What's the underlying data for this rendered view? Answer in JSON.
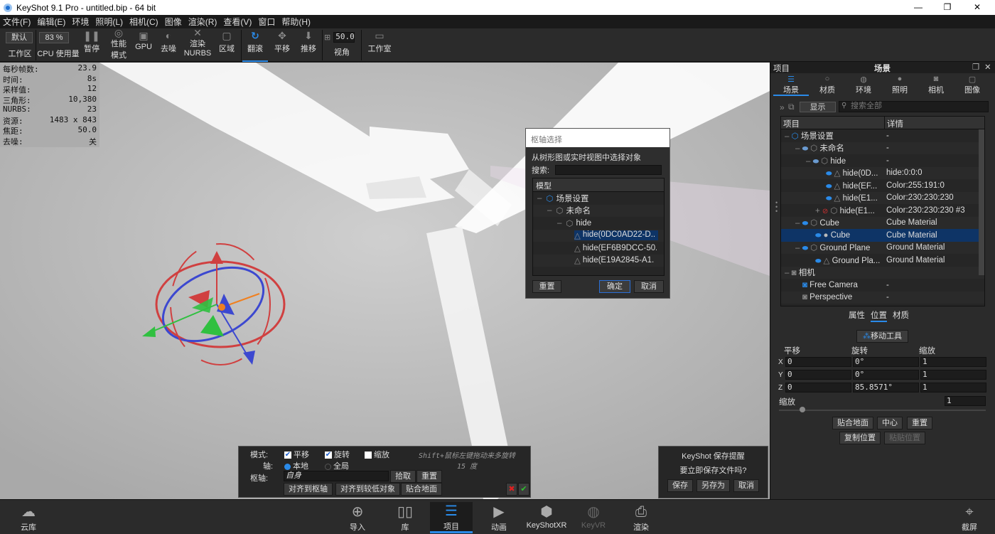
{
  "window": {
    "title": "KeyShot 9.1 Pro  - untitled.bip  - 64 bit",
    "minimize": "—",
    "maximize": "❐",
    "close": "✕"
  },
  "menu": [
    "文件(F)",
    "编辑(E)",
    "环境",
    "照明(L)",
    "相机(C)",
    "图像",
    "渲染(R)",
    "查看(V)",
    "窗口",
    "帮助(H)"
  ],
  "toolbar": {
    "workspace_value": "默认",
    "workspace_label": "工作区",
    "cpu_value": "83 %",
    "cpu_label": "CPU 使用量",
    "pause": "暂停",
    "perf_line1": "性能",
    "perf_line2": "模式",
    "gpu": "GPU",
    "denoise": "去噪",
    "nurbs_line1": "渲染",
    "nurbs_line2": "NURBS",
    "region": "区域",
    "tumble": "翻滚",
    "pan": "平移",
    "dolly": "推移",
    "fov_value": "50.0",
    "fov_label": "视角",
    "studio": "工作室"
  },
  "stats": [
    {
      "k": "每秒帧数:",
      "v": "23.9"
    },
    {
      "k": "时间:",
      "v": "8s"
    },
    {
      "k": "采样值:",
      "v": "12"
    },
    {
      "k": "三角形:",
      "v": "10,380"
    },
    {
      "k": "NURBS:",
      "v": "23"
    },
    {
      "k": "资源:",
      "v": "1483 x 843"
    },
    {
      "k": "焦距:",
      "v": "50.0"
    },
    {
      "k": "去噪:",
      "v": "关"
    }
  ],
  "pivot_dialog": {
    "title": "枢轴选择",
    "instruction": "从树形图或实时视图中选择对象",
    "search_label": "搜索:",
    "search_value": "",
    "column": "模型",
    "rows": [
      {
        "label": "场景设置"
      },
      {
        "label": "未命名"
      },
      {
        "label": "hide"
      },
      {
        "label": "hide(0DC0AD22-D.."
      },
      {
        "label": "hide(EF6B9DCC-50.."
      },
      {
        "label": "hide(E19A2845-A1."
      }
    ],
    "reset": "重置",
    "ok": "确定",
    "cancel": "取消"
  },
  "move_tool": {
    "mode_label": "模式:",
    "translate": "平移",
    "translate_checked": true,
    "rotate": "旋转",
    "rotate_checked": true,
    "scale": "缩放",
    "scale_checked": false,
    "hint_line1": "Shift+鼠标左键拖动来多旋转",
    "hint_line2": "15 度",
    "axis_label": "轴:",
    "local": "本地",
    "global": "全局",
    "axis_selected": "本地",
    "pivot_label": "枢轴:",
    "pivot_value": "自身",
    "pick": "拾取",
    "reset": "重置",
    "align_pivot": "对齐到枢轴",
    "align_lower": "对齐到较低对象",
    "snap_ground": "贴合地面",
    "cancel_icon": "✖",
    "confirm_icon": "✔"
  },
  "save_reminder": {
    "title": "KeyShot 保存提醒",
    "question": "要立即保存文件吗?",
    "save": "保存",
    "save_as": "另存为",
    "cancel": "取消"
  },
  "right_panel": {
    "left_title": "项目",
    "title": "场景",
    "tabs": [
      {
        "label": "场景",
        "icon": "list-icon"
      },
      {
        "label": "材质",
        "icon": "sphere-icon"
      },
      {
        "label": "环境",
        "icon": "globe-icon"
      },
      {
        "label": "照明",
        "icon": "bulb-icon"
      },
      {
        "label": "相机",
        "icon": "camera-icon"
      },
      {
        "label": "图像",
        "icon": "image-icon"
      }
    ],
    "active_tab": "场景",
    "show_select": "显示",
    "search_placeholder": "搜索全部",
    "tree_headers": [
      "项目",
      "详情"
    ],
    "tree": [
      {
        "name": "场景设置",
        "detail": "-"
      },
      {
        "name": "未命名",
        "detail": "-"
      },
      {
        "name": "hide",
        "detail": "-"
      },
      {
        "name": "hide(0D...",
        "detail": "hide:0:0:0"
      },
      {
        "name": "hide(EF...",
        "detail": "Color:255:191:0"
      },
      {
        "name": "hide(E1...",
        "detail": "Color:230:230:230"
      },
      {
        "name": "hide(E1...",
        "detail": "Color:230:230:230 #3"
      },
      {
        "name": "Cube",
        "detail": "Cube Material"
      },
      {
        "name": "Cube",
        "detail": "Cube Material"
      },
      {
        "name": "Ground Plane",
        "detail": "Ground Material"
      },
      {
        "name": "Ground Pla...",
        "detail": "Ground Material"
      },
      {
        "name": "相机",
        "detail": ""
      },
      {
        "name": "Free Camera",
        "detail": "-"
      },
      {
        "name": "Perspective",
        "detail": "-"
      }
    ],
    "sub_tabs": [
      "属性",
      "位置",
      "材质"
    ],
    "active_sub_tab": "位置",
    "move_tool_button": "移动工具",
    "col_translate": "平移",
    "col_rotate": "旋转",
    "col_scale": "缩放",
    "xyz": [
      {
        "axis": "X",
        "t": "0",
        "r": "0°",
        "s": "1"
      },
      {
        "axis": "Y",
        "t": "0",
        "r": "0°",
        "s": "1"
      },
      {
        "axis": "Z",
        "t": "0",
        "r": "85.8571°",
        "s": "1"
      }
    ],
    "uniform_scale_label": "缩放",
    "uniform_scale_value": "1",
    "snap_ground": "贴合地面",
    "center": "中心",
    "reset": "重置",
    "copy_pos": "复制位置",
    "paste_pos": "粘贴位置"
  },
  "bottom": {
    "cloud": "云库",
    "import": "导入",
    "library": "库",
    "project": "项目",
    "animation": "动画",
    "keyshotxr": "KeyShotXR",
    "keyvr": "KeyVR",
    "render": "渲染",
    "screenshot": "截屏",
    "active": "项目"
  },
  "colors": {
    "accent": "#2a8ae8",
    "selection": "#0e3466",
    "panel": "#2b2b2b"
  }
}
